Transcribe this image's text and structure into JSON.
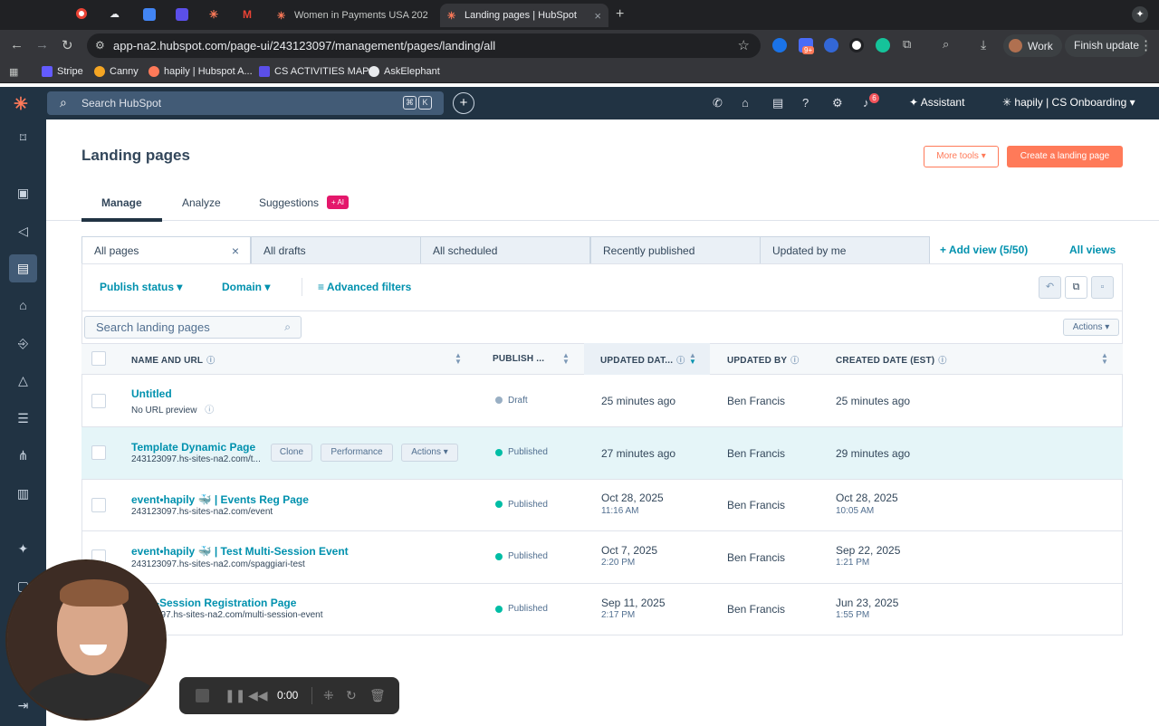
{
  "browser": {
    "tabs": [
      {
        "title": "",
        "color": "#ea4335"
      },
      {
        "title": "",
        "color": "#e8eaed"
      },
      {
        "title": "",
        "color": "#4285f4"
      },
      {
        "title": "",
        "color": "#5b4fe9"
      },
      {
        "title": "",
        "color": "#ff7a59"
      },
      {
        "title": "",
        "color": "#ea4335"
      },
      {
        "title": "Women in Payments USA 202",
        "color": "#ff7a59"
      },
      {
        "title": "Landing pages | HubSpot",
        "color": "#ff7a59"
      }
    ],
    "url": "app-na2.hubspot.com/page-ui/243123097/management/pages/landing/all",
    "profile": "Work",
    "update": "Finish update",
    "ext_badge": "9+",
    "bookmarks": [
      "Stripe",
      "Canny",
      "hapily | Hubspot A...",
      "CS ACTIVITIES MAP",
      "AskElephant"
    ]
  },
  "hubspot": {
    "search_placeholder": "Search HubSpot",
    "kbd1": "⌘",
    "kbd2": "K",
    "notifications": "6",
    "assistant": "Assistant",
    "account": "hapily | CS Onboarding"
  },
  "page": {
    "title": "Landing pages",
    "more_tools": "More tools ▾",
    "create": "Create a landing page",
    "tabs": {
      "manage": "Manage",
      "analyze": "Analyze",
      "suggestions": "Suggestions",
      "ai_badge": "+ AI"
    },
    "views": [
      "All pages",
      "All drafts",
      "All scheduled",
      "Recently published",
      "Updated by me"
    ],
    "add_view": "+ Add view (5/50)",
    "all_views": "All views",
    "filters": {
      "publish_status": "Publish status ▾",
      "domain": "Domain ▾",
      "advanced": "Advanced filters"
    },
    "search_placeholder": "Search landing pages",
    "actions": "Actions ▾"
  },
  "table": {
    "columns": {
      "name": "NAME AND URL",
      "publish": "PUBLISH ...",
      "updated_date": "UPDATED DAT...",
      "updated_by": "UPDATED BY",
      "created": "CREATED DATE (EST)"
    },
    "rows": [
      {
        "name": "Untitled",
        "url": "No URL preview",
        "status": "Draft",
        "status_color": "#99afc4",
        "updated": "25 minutes ago",
        "updated_time": "",
        "updated_by": "Ben Francis",
        "created": "25 minutes ago",
        "created_time": ""
      },
      {
        "name": "Template Dynamic Page",
        "url": "243123097.hs-sites-na2.com/t...",
        "status": "Published",
        "status_color": "#00bda5",
        "updated": "27 minutes ago",
        "updated_time": "",
        "updated_by": "Ben Francis",
        "created": "29 minutes ago",
        "created_time": ""
      },
      {
        "name": "event•hapily 🐳 | Events Reg Page",
        "url": "243123097.hs-sites-na2.com/event",
        "status": "Published",
        "status_color": "#00bda5",
        "updated": "Oct 28, 2025",
        "updated_time": "11:16 AM",
        "updated_by": "Ben Francis",
        "created": "Oct 28, 2025",
        "created_time": "10:05 AM"
      },
      {
        "name": "event•hapily 🐳 | Test Multi-Session Event",
        "url": "243123097.hs-sites-na2.com/spaggiari-test",
        "status": "Published",
        "status_color": "#00bda5",
        "updated": "Oct 7, 2025",
        "updated_time": "2:20 PM",
        "updated_by": "Ben Francis",
        "created": "Sep 22, 2025",
        "created_time": "1:21 PM"
      },
      {
        "name": "-Session Registration Page",
        "url": "097.hs-sites-na2.com/multi-session-event",
        "status": "Published",
        "status_color": "#00bda5",
        "updated": "Sep 11, 2025",
        "updated_time": "2:17 PM",
        "updated_by": "Ben Francis",
        "created": "Jun 23, 2025",
        "created_time": "1:55 PM"
      }
    ],
    "row_actions": {
      "clone": "Clone",
      "performance": "Performance",
      "actions": "Actions ▾"
    }
  },
  "recorder": {
    "time": "0:00"
  }
}
